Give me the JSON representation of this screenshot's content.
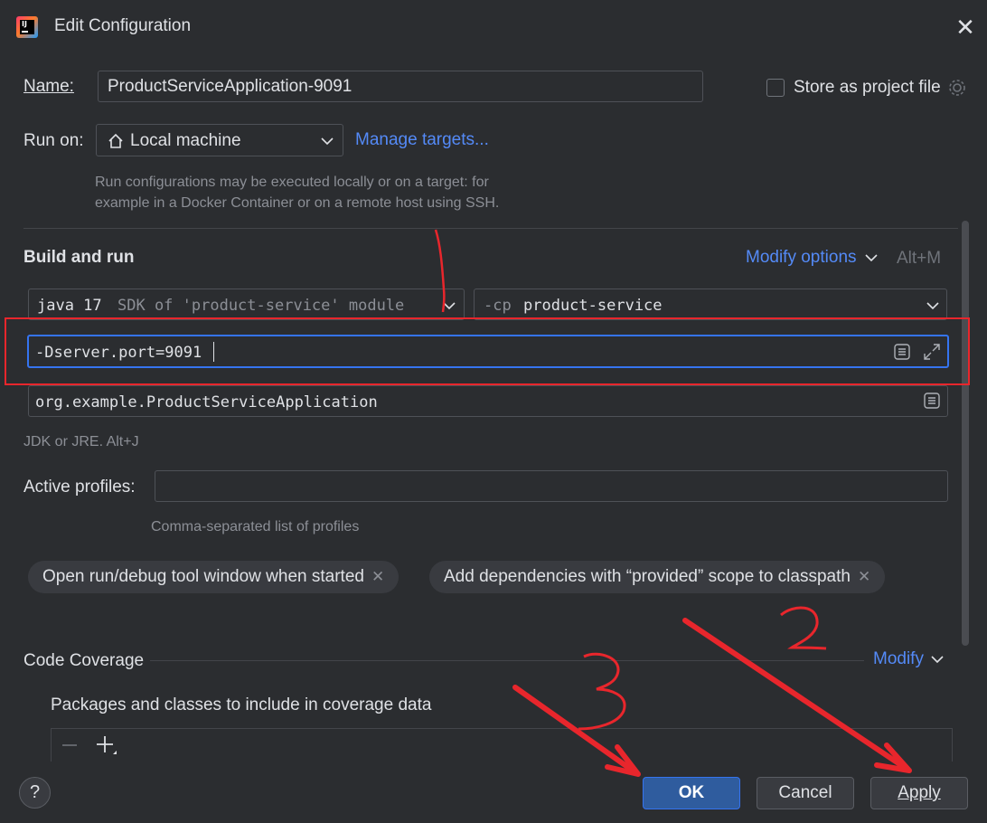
{
  "window": {
    "title": "Edit Configuration",
    "close_glyph": "✕"
  },
  "name_row": {
    "label": "Name:",
    "value": "ProductServiceApplication-9091",
    "store_label": "Store as project file"
  },
  "run_on": {
    "label": "Run on:",
    "value": "Local machine",
    "manage_link": "Manage targets...",
    "hint_line1": "Run configurations may be executed locally or on a target: for",
    "hint_line2": "example in a Docker Container or on a remote host using SSH."
  },
  "build_run": {
    "title": "Build and run",
    "modify_options": "Modify options",
    "shortcut": "Alt+M",
    "jdk_java": "java 17",
    "jdk_rest": "SDK of 'product-service' module",
    "cp_prefix": "-cp",
    "cp_value": "product-service",
    "vm_options": "-Dserver.port=9091",
    "main_class": "org.example.ProductServiceApplication",
    "hint": "JDK or JRE. Alt+J"
  },
  "profiles": {
    "label": "Active profiles:",
    "value": "",
    "hint": "Comma-separated list of profiles"
  },
  "chips": [
    {
      "label": "Open run/debug tool window when started"
    },
    {
      "label": "Add dependencies with “provided” scope to classpath"
    }
  ],
  "coverage": {
    "title": "Code Coverage",
    "modify": "Modify",
    "packages_label": "Packages and classes to include in coverage data"
  },
  "buttons": {
    "help": "?",
    "ok": "OK",
    "cancel": "Cancel",
    "apply": "Apply"
  },
  "colors": {
    "accent": "#548af7",
    "annotation": "#e8262c",
    "primary_button": "#2f5c9e"
  }
}
